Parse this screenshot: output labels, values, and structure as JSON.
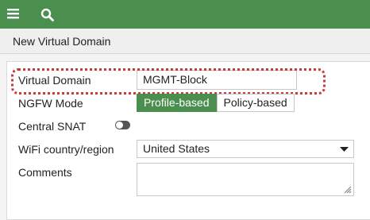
{
  "header": {
    "menu_icon": "hamburger-menu-icon",
    "search_icon": "search-icon",
    "bar_color": "#4b8f4f"
  },
  "page": {
    "title": "New Virtual Domain"
  },
  "form": {
    "virtual_domain": {
      "label": "Virtual Domain",
      "value": "MGMT-Block"
    },
    "ngfw_mode": {
      "label": "NGFW Mode",
      "options": [
        "Profile-based",
        "Policy-based"
      ],
      "selected": "Profile-based"
    },
    "central_snat": {
      "label": "Central SNAT",
      "enabled": false
    },
    "wifi_country": {
      "label": "WiFi country/region",
      "value": "United States"
    },
    "comments": {
      "label": "Comments",
      "value": ""
    }
  },
  "highlight_color": "#c83a3a"
}
